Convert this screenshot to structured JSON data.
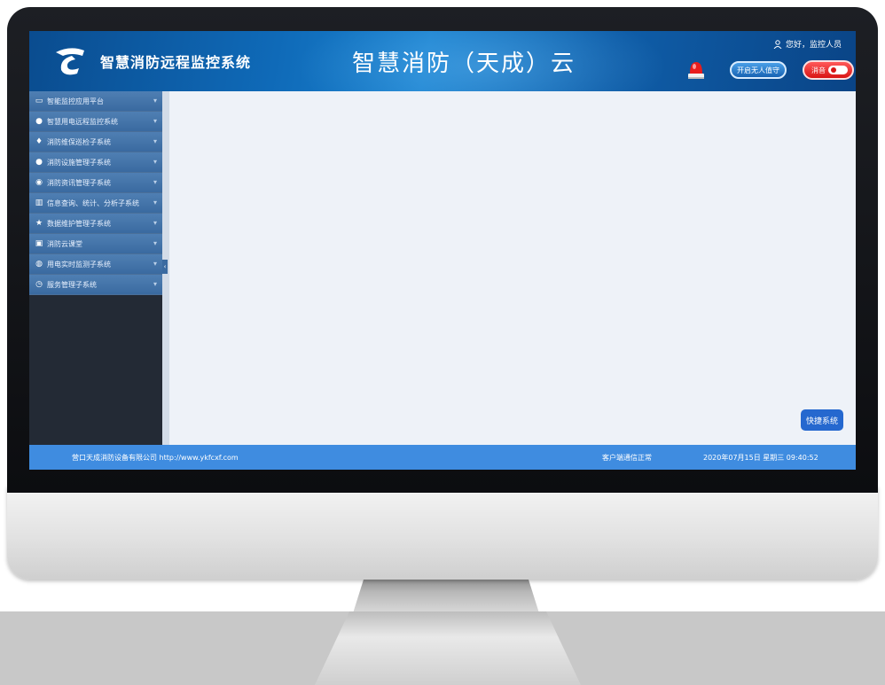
{
  "header": {
    "app_title": "智慧消防远程监控系统",
    "cloud_title": "智慧消防（天成）云",
    "user_greeting": "您好，监控人员",
    "unmanned_button": "开启无人值守",
    "mute_button": "消音",
    "icons": {
      "logo": "company-logo",
      "user": "user-icon",
      "alarm": "alarm-light-icon"
    }
  },
  "sidebar": {
    "items": [
      {
        "label": "智能监控应用平台",
        "icon": "monitor-icon"
      },
      {
        "label": "智慧用电远程监控系统",
        "icon": "power-icon"
      },
      {
        "label": "消防维保巡检子系统",
        "icon": "maintenance-icon"
      },
      {
        "label": "消防设施管理子系统",
        "icon": "facility-icon"
      },
      {
        "label": "消防资讯管理子系统",
        "icon": "info-icon"
      },
      {
        "label": "信息查询、统计、分析子系统",
        "icon": "chart-icon"
      },
      {
        "label": "数据维护管理子系统",
        "icon": "star-icon"
      },
      {
        "label": "消防云课堂",
        "icon": "classroom-icon"
      },
      {
        "label": "用电实时监测子系统",
        "icon": "realtime-icon"
      },
      {
        "label": "服务管理子系统",
        "icon": "service-icon"
      }
    ]
  },
  "main": {
    "quick_button": "快捷系统"
  },
  "footer": {
    "company": "营口天成消防设备有限公司 http://www.ykfcxf.com",
    "status": "客户端通信正常",
    "datetime": "2020年07月15日 星期三 09:40:52"
  },
  "colors": {
    "header_blue": "#0f6ab8",
    "sidebar_item": "#3a6aa0",
    "sidebar_bg": "#232a35",
    "content_bg": "#eef2f8",
    "footer_blue": "#3f8ce0",
    "quick_button": "#2568cf",
    "mute_red": "#d81414"
  }
}
